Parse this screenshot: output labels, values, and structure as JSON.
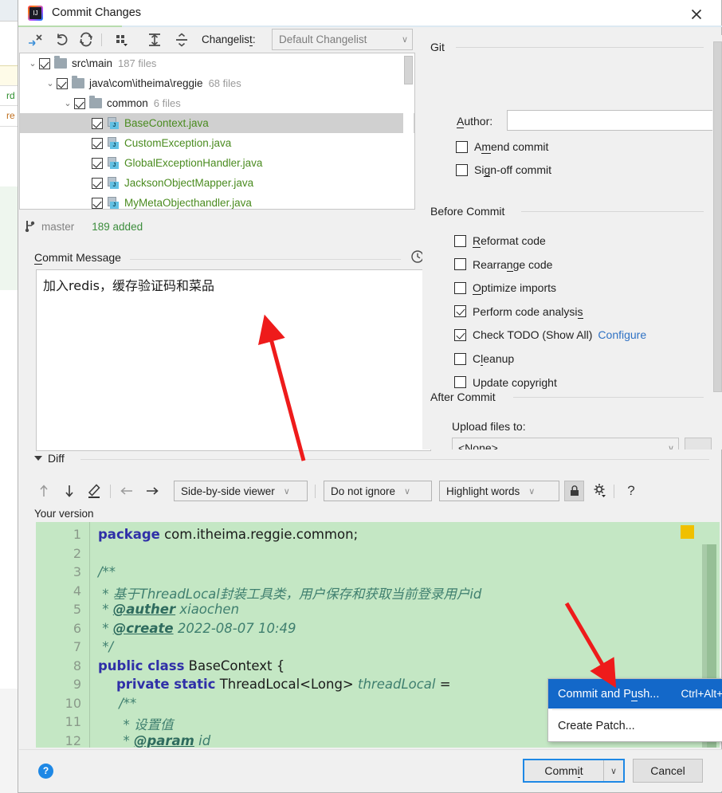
{
  "window": {
    "title": "Commit Changes",
    "app_icon": "intellij-idea-icon",
    "close_icon": "close-icon"
  },
  "toolbar": {
    "icons": [
      {
        "name": "show-diff-icon",
        "glyph": "arrows-in"
      },
      {
        "name": "revert-icon",
        "glyph": "undo"
      },
      {
        "name": "refresh-icon",
        "glyph": "refresh"
      },
      {
        "name": "group-by-icon",
        "glyph": "group"
      },
      {
        "name": "expand-all-icon",
        "glyph": "expand"
      },
      {
        "name": "collapse-all-icon",
        "glyph": "collapse"
      }
    ],
    "changelist_label": "Changelist:",
    "changelist_value": "Default Changelist"
  },
  "file_tree": {
    "nodes": [
      {
        "indent": 0,
        "twisty": "⌄",
        "checked": true,
        "kind": "folder",
        "name": "src\\main",
        "count": "187 files",
        "selected": false
      },
      {
        "indent": 1,
        "twisty": "⌄",
        "checked": true,
        "kind": "folder",
        "name": "java\\com\\itheima\\reggie",
        "count": "68 files",
        "selected": false
      },
      {
        "indent": 2,
        "twisty": "⌄",
        "checked": true,
        "kind": "folder",
        "name": "common",
        "count": "6 files",
        "selected": false
      },
      {
        "indent": 3,
        "twisty": "",
        "checked": true,
        "kind": "java",
        "name": "BaseContext.java",
        "count": "",
        "selected": true
      },
      {
        "indent": 3,
        "twisty": "",
        "checked": true,
        "kind": "java",
        "name": "CustomException.java",
        "count": "",
        "selected": false
      },
      {
        "indent": 3,
        "twisty": "",
        "checked": true,
        "kind": "java",
        "name": "GlobalExceptionHandler.java",
        "count": "",
        "selected": false
      },
      {
        "indent": 3,
        "twisty": "",
        "checked": true,
        "kind": "java",
        "name": "JacksonObjectMapper.java",
        "count": "",
        "selected": false
      },
      {
        "indent": 3,
        "twisty": "",
        "checked": true,
        "kind": "java",
        "name": "MyMetaObjecthandler.java",
        "count": "",
        "selected": false
      }
    ]
  },
  "branch_bar": {
    "icon": "git-branch-icon",
    "branch": "master",
    "stat": "189 added"
  },
  "commit_message": {
    "label_prefix": "C",
    "label_rest": "ommit Message",
    "history_icon": "clock-history-icon",
    "value": "加入redis，缓存验证码和菜品"
  },
  "right_panel": {
    "git": {
      "heading": "Git",
      "author_label_prefix": "A",
      "author_label_rest": "uthor:",
      "author_value": "",
      "author_placeholder": "",
      "options": [
        {
          "name": "amend-commit",
          "label_pre": "A",
          "label_mid": "m",
          "label_post": "end commit",
          "checked": false
        },
        {
          "name": "sign-off-commit",
          "label_pre": "Si",
          "label_mid": "g",
          "label_post": "n-off commit",
          "checked": false
        }
      ]
    },
    "before_commit": {
      "heading": "Before Commit",
      "options": [
        {
          "name": "reformat-code",
          "label_pre": "",
          "label_mid": "R",
          "label_post": "eformat code",
          "checked": false,
          "link": ""
        },
        {
          "name": "rearrange-code",
          "label_pre": "Rearra",
          "label_mid": "n",
          "label_post": "ge code",
          "checked": false,
          "link": ""
        },
        {
          "name": "optimize-imports",
          "label_pre": "",
          "label_mid": "O",
          "label_post": "ptimize imports",
          "checked": false,
          "link": ""
        },
        {
          "name": "perform-code-analysis",
          "label_pre": "Perform code analysi",
          "label_mid": "s",
          "label_post": "",
          "checked": true,
          "link": ""
        },
        {
          "name": "check-todo",
          "label_pre": "Check TODO (Show All)",
          "label_mid": "",
          "label_post": "",
          "checked": true,
          "link": "Configure"
        },
        {
          "name": "cleanup",
          "label_pre": "C",
          "label_mid": "l",
          "label_post": "eanup",
          "checked": false,
          "link": ""
        },
        {
          "name": "update-copyright",
          "label_pre": "Update copyright",
          "label_mid": "",
          "label_post": "",
          "checked": false,
          "link": ""
        }
      ]
    },
    "after_commit": {
      "heading": "After Commit",
      "upload_label": "Upload files to:",
      "upload_value": "<None>"
    }
  },
  "diff": {
    "section_label": "Diff",
    "toolbar": {
      "icons": [
        {
          "name": "previous-difference-icon",
          "glyph": "↑"
        },
        {
          "name": "next-difference-icon",
          "glyph": "↓"
        },
        {
          "name": "edit-source-icon",
          "glyph": "pencil"
        },
        {
          "name": "apply-left-icon",
          "glyph": "←"
        },
        {
          "name": "apply-right-icon",
          "glyph": "→"
        }
      ],
      "viewer_mode": "Side-by-side viewer",
      "ignore_policy": "Do not ignore",
      "highlight_policy": "Highlight words",
      "lock_icon": "lock-icon",
      "settings_icon": "gear-icon",
      "help_icon": "question-mark-icon"
    },
    "pane_label": "Your version",
    "lines": [
      {
        "n": "1",
        "segments": [
          {
            "t": "package",
            "c": "kw"
          },
          {
            "t": " com.itheima.reggie.common;",
            "c": "pl"
          }
        ]
      },
      {
        "n": "2",
        "segments": []
      },
      {
        "n": "3",
        "segments": [
          {
            "t": "/**",
            "c": "cm"
          }
        ]
      },
      {
        "n": "4",
        "segments": [
          {
            "t": " * 基于ThreadLocal封装工具类，用户保存和获取当前登录用户id",
            "c": "cm"
          }
        ]
      },
      {
        "n": "5",
        "segments": [
          {
            "t": " * ",
            "c": "cm"
          },
          {
            "t": "@auther",
            "c": "tag"
          },
          {
            "t": " xiaochen",
            "c": "cm"
          }
        ]
      },
      {
        "n": "6",
        "segments": [
          {
            "t": " * ",
            "c": "cm"
          },
          {
            "t": "@create",
            "c": "tag"
          },
          {
            "t": " 2022-08-07 10:49",
            "c": "cm"
          }
        ]
      },
      {
        "n": "7",
        "segments": [
          {
            "t": " */",
            "c": "cm"
          }
        ]
      },
      {
        "n": "8",
        "segments": [
          {
            "t": "public class",
            "c": "kw"
          },
          {
            "t": " BaseContext {",
            "c": "pl"
          }
        ]
      },
      {
        "n": "9",
        "segments": [
          {
            "t": "    private static",
            "c": "kw"
          },
          {
            "t": " ThreadLocal<Long> ",
            "c": "pl"
          },
          {
            "t": "threadLocal",
            "c": "cm"
          },
          {
            "t": " =",
            "c": "pl"
          }
        ]
      },
      {
        "n": "10",
        "segments": [
          {
            "t": "     /**",
            "c": "cm"
          }
        ]
      },
      {
        "n": "11",
        "segments": [
          {
            "t": "      * 设置值",
            "c": "cm"
          }
        ]
      },
      {
        "n": "12",
        "segments": [
          {
            "t": "      * ",
            "c": "cm"
          },
          {
            "t": "@param",
            "c": "tag"
          },
          {
            "t": " id",
            "c": "cm"
          }
        ]
      }
    ]
  },
  "popup_menu": {
    "items": [
      {
        "name": "commit-and-push",
        "label_pre": "Commit and P",
        "label_mid": "u",
        "label_post": "sh...",
        "accel": "Ctrl+Alt+K",
        "active": true
      },
      {
        "name": "create-patch",
        "label_pre": "Create Patch...",
        "label_mid": "",
        "label_post": "",
        "accel": "",
        "active": false
      }
    ]
  },
  "bottom_bar": {
    "help_icon": "question-mark-icon",
    "help_glyph": "?",
    "commit_label_pre": "Comm",
    "commit_label_mid": "i",
    "commit_label_post": "t",
    "commit_dropdown_glyph": "∨",
    "cancel_label": "Cancel"
  },
  "colors": {
    "accent_blue": "#1368c9",
    "focus_blue": "#1e88e5",
    "link_blue": "#2f72c4",
    "diff_added_bg": "#c4e7c4",
    "java_file_text": "#4a8b1f",
    "added_stat": "#3c8d3c",
    "annotation_arrow": "#ee1b1b"
  }
}
